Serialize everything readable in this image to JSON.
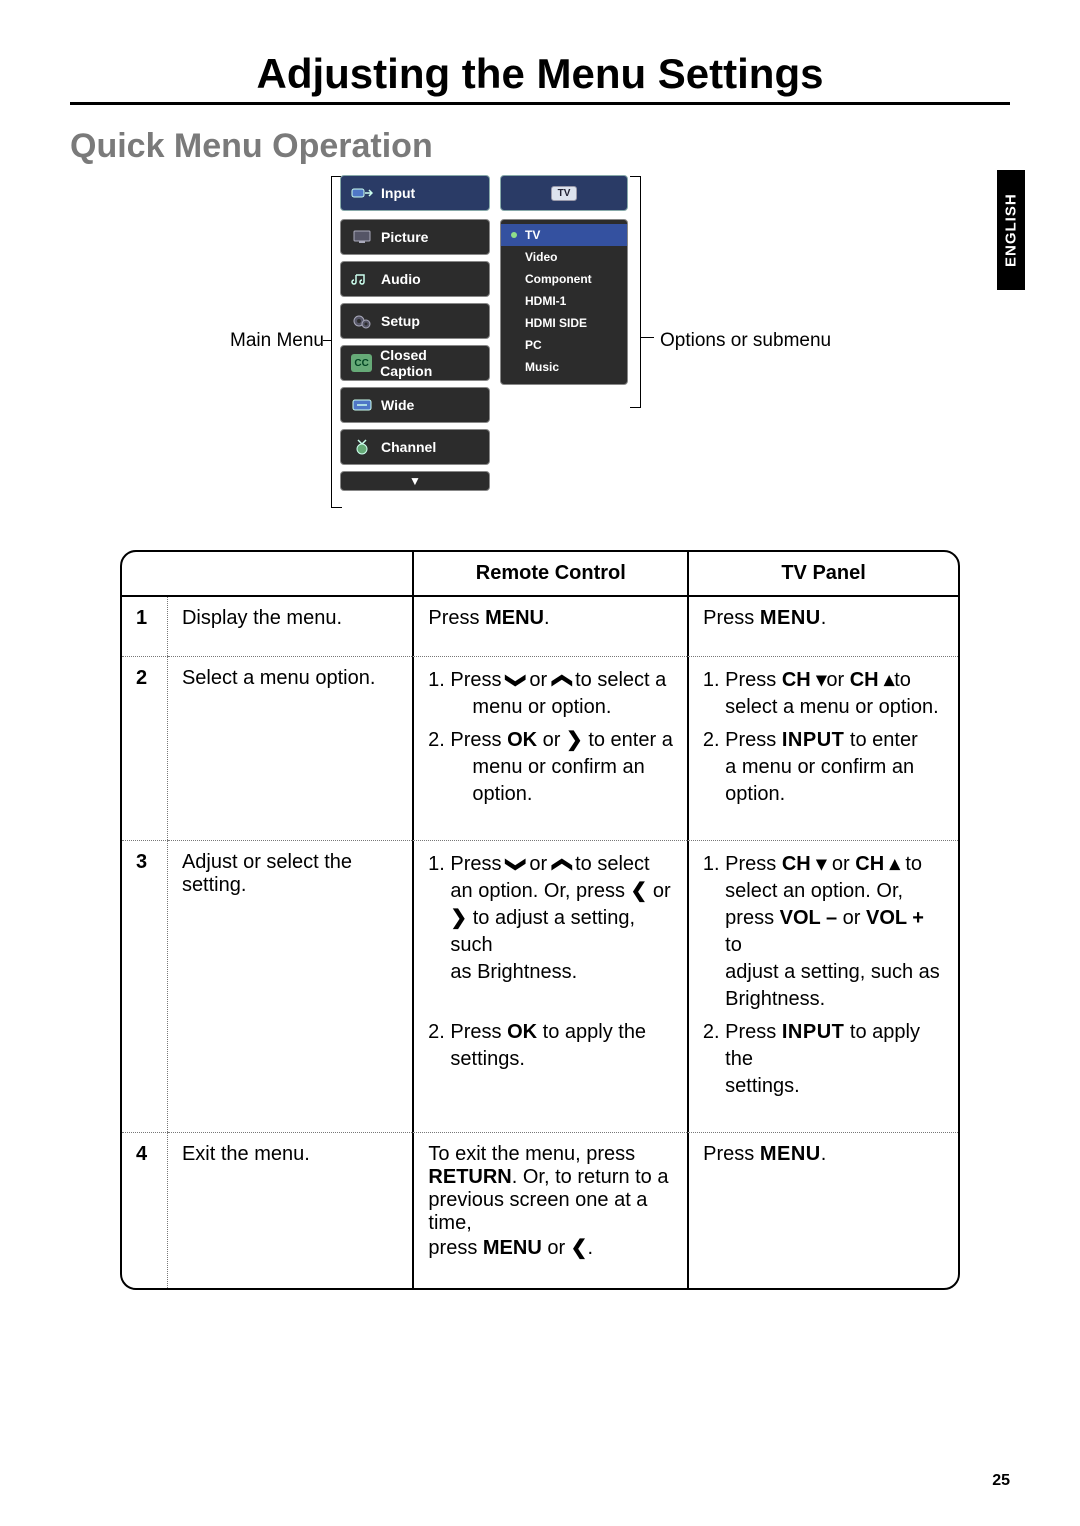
{
  "title": "Adjusting the Menu Settings",
  "subtitle": "Quick Menu Operation",
  "language_tab": "ENGLISH",
  "page_number": "25",
  "diagram": {
    "main_menu_label": "Main Menu",
    "options_label": "Options or submenu",
    "main_items": [
      "Input",
      "Picture",
      "Audio",
      "Setup",
      "Closed Caption",
      "Wide",
      "Channel"
    ],
    "sub_selected_badge": "TV",
    "sub_items": [
      "TV",
      "Video",
      "Component",
      "HDMI-1",
      "HDMI SIDE",
      "PC",
      "Music"
    ]
  },
  "table": {
    "headers": {
      "blank": "",
      "remote": "Remote Control",
      "panel": "TV Panel"
    },
    "rows": [
      {
        "num": "1",
        "desc": "Display the menu.",
        "remote_prefix": "Press ",
        "remote_key": "MENU",
        "panel_prefix": "Press ",
        "panel_key": "MENU"
      },
      {
        "num": "2",
        "desc": "Select a menu option.",
        "remote": {
          "l1a": "Press ",
          "l1b": " or ",
          "l1c": " to select a",
          "l1_ind": "menu or option.",
          "l2a": "Press ",
          "l2_ok": "OK",
          "l2b": " or ",
          "l2c": " to enter a",
          "l2_ind": "menu or confirm an option."
        },
        "panel": {
          "l1a": "Press ",
          "l1_chdn": "CH",
          "l1b": "or ",
          "l1_chup": "CH",
          "l1c": "to",
          "l1_ind": "select a menu or option.",
          "l2a": "Press ",
          "l2_input": "INPUT",
          "l2b": " to enter",
          "l2_ind1": "a menu or confirm an",
          "l2_ind2": "option."
        }
      },
      {
        "num": "3",
        "desc1": "Adjust or select the",
        "desc2": "setting.",
        "remote": {
          "l1a": "Press ",
          "l1b": " or ",
          "l1c": " to select",
          "l1_ind1a": "an option. Or, press ",
          "l1_ind1b": " or",
          "l1_ind2a": "",
          "l1_ind2b": " to adjust a setting, such",
          "l1_ind3": "as Brightness.",
          "l2a": "Press ",
          "l2_ok": "OK",
          "l2b": "  to apply the",
          "l2_ind": "settings."
        },
        "panel": {
          "l1a": "Press ",
          "l1_chdn": "CH",
          "l1b": " or ",
          "l1_chup": "CH",
          "l1c": " to",
          "l1_ind1": "select an option. Or,",
          "l1_ind2a": "press ",
          "l1_volm": "VOL –",
          "l1_ind2b": " or ",
          "l1_volp": "VOL +",
          "l1_ind2c": " to",
          "l1_ind3": "adjust a setting, such as",
          "l1_ind4": "Brightness.",
          "l2a": "Press ",
          "l2_input": "INPUT",
          "l2b": "  to apply the",
          "l2_ind": "settings."
        }
      },
      {
        "num": "4",
        "desc": "Exit the menu.",
        "remote": {
          "t1": "To exit the menu, press",
          "t2a": "RETURN",
          "t2b": ". Or, to return to a",
          "t3": "previous screen one at a time,",
          "t4a": "press ",
          "t4_menu": "MENU",
          "t4b": " or "
        },
        "panel_prefix": "Press ",
        "panel_key": "MENU"
      }
    ]
  },
  "glyph": {
    "down": "❯",
    "up": "❯",
    "left": "❮",
    "right": "❯",
    "tri_down": "▾",
    "tri_up": "▴"
  }
}
